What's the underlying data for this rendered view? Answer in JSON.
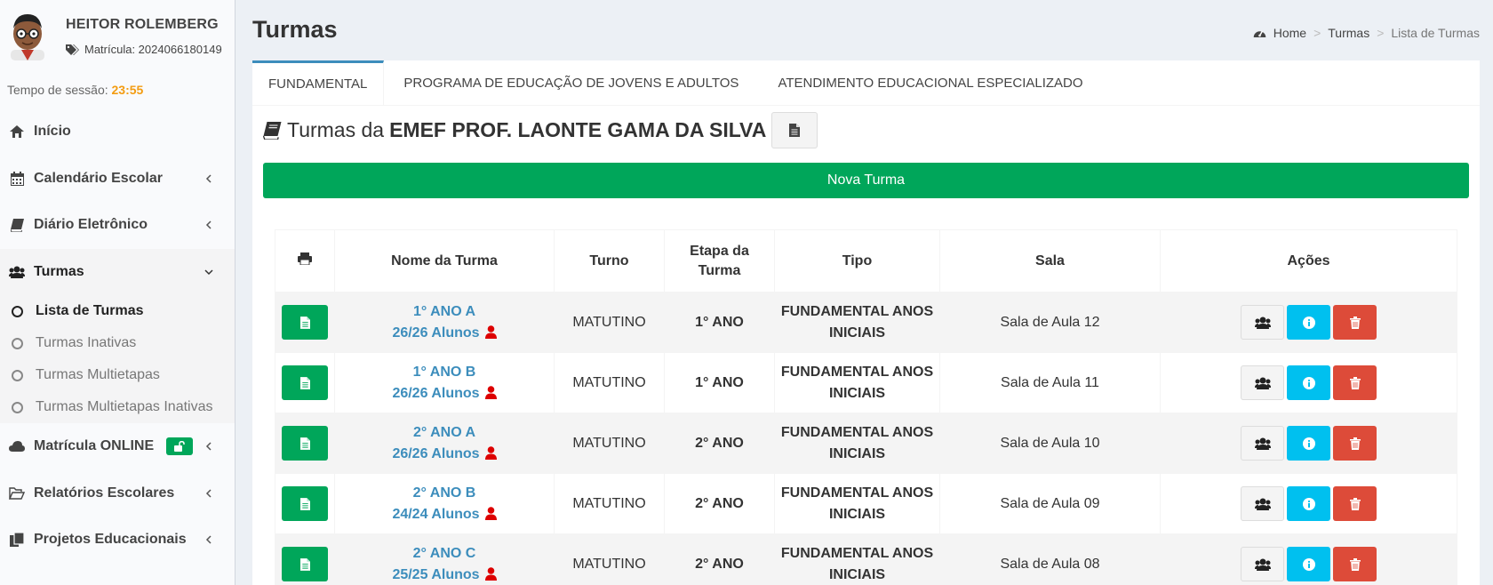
{
  "user": {
    "name": "HEITOR ROLEMBERG",
    "matricula": "Matrícula: 2024066180149"
  },
  "session": {
    "label": "Tempo de sessão:",
    "time": "23:55"
  },
  "menu": {
    "inicio": "Início",
    "calendario": "Calendário Escolar",
    "diario": "Diário Eletrônico",
    "turmas": "Turmas",
    "sub": [
      "Lista de Turmas",
      "Turmas Inativas",
      "Turmas Multietapas",
      "Turmas Multietapas Inativas"
    ],
    "matricula": "Matrícula ONLINE",
    "relatorios": "Relatórios Escolares",
    "projetos": "Projetos Educacionais"
  },
  "header": {
    "title": "Turmas"
  },
  "breadcrumb": {
    "home": "Home",
    "turmas": "Turmas",
    "current": "Lista de Turmas"
  },
  "tabs": [
    "FUNDAMENTAL",
    "PROGRAMA DE EDUCAÇÃO DE JOVENS E ADULTOS",
    "ATENDIMENTO EDUCACIONAL ESPECIALIZADO"
  ],
  "box": {
    "title_prefix": "Turmas da",
    "school": "EMEF PROF. LAONTE GAMA DA SILVA"
  },
  "nova_turma": "Nova Turma",
  "table": {
    "headers": {
      "nome": "Nome da Turma",
      "turno": "Turno",
      "etapa1": "Etapa da",
      "etapa2": "Turma",
      "tipo": "Tipo",
      "sala": "Sala",
      "acoes": "Ações"
    },
    "rows": [
      {
        "nome": "1° ANO A",
        "alunos": "26/26 Alunos",
        "turno": "MATUTINO",
        "etapa": "1° ANO",
        "tipo1": "FUNDAMENTAL ANOS",
        "tipo2": "INICIAIS",
        "sala": "Sala de Aula 12"
      },
      {
        "nome": "1° ANO B",
        "alunos": "26/26 Alunos",
        "turno": "MATUTINO",
        "etapa": "1° ANO",
        "tipo1": "FUNDAMENTAL ANOS",
        "tipo2": "INICIAIS",
        "sala": "Sala de Aula 11"
      },
      {
        "nome": "2° ANO A",
        "alunos": "26/26 Alunos",
        "turno": "MATUTINO",
        "etapa": "2° ANO",
        "tipo1": "FUNDAMENTAL ANOS",
        "tipo2": "INICIAIS",
        "sala": "Sala de Aula 10"
      },
      {
        "nome": "2° ANO B",
        "alunos": "24/24 Alunos",
        "turno": "MATUTINO",
        "etapa": "2° ANO",
        "tipo1": "FUNDAMENTAL ANOS",
        "tipo2": "INICIAIS",
        "sala": "Sala de Aula 09"
      },
      {
        "nome": "2° ANO C",
        "alunos": "25/25 Alunos",
        "turno": "MATUTINO",
        "etapa": "2° ANO",
        "tipo1": "FUNDAMENTAL ANOS",
        "tipo2": "INICIAIS",
        "sala": "Sala de Aula 08"
      }
    ]
  },
  "colors": {
    "green": "#00a65a",
    "blue": "#3c8dbc",
    "info": "#00c0ef",
    "danger": "#dd4b39",
    "warning": "#f39c12"
  }
}
